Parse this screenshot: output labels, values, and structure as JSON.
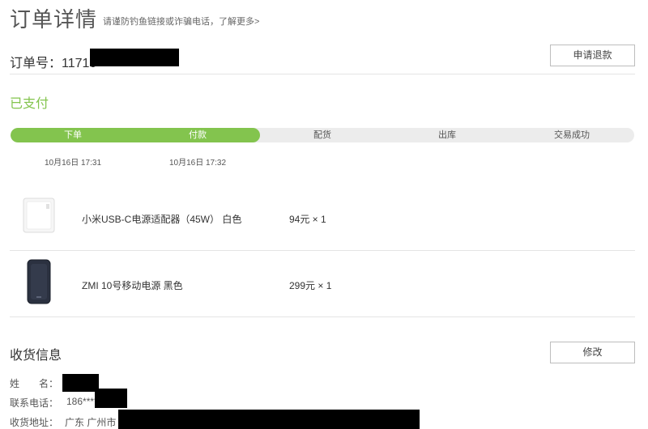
{
  "header": {
    "title": "订单详情",
    "subtitle": "请谨防钓鱼链接或诈骗电话，了解更多>"
  },
  "order": {
    "label": "订单号：",
    "number_visible": "11710",
    "refund_button": "申请退款"
  },
  "status": {
    "text": "已支付",
    "accent_color": "#83c44e",
    "progress_fraction": 0.4,
    "steps": [
      {
        "label": "下单",
        "time": "10月16日 17:31",
        "done": true
      },
      {
        "label": "付款",
        "time": "10月16日 17:32",
        "done": true
      },
      {
        "label": "配货",
        "time": "",
        "done": false
      },
      {
        "label": "出库",
        "time": "",
        "done": false
      },
      {
        "label": "交易成功",
        "time": "",
        "done": false
      }
    ]
  },
  "products": [
    {
      "name": "小米USB-C电源适配器（45W） 白色",
      "price": "94元 × 1",
      "thumb_icon": "power-adapter-icon"
    },
    {
      "name": "ZMI 10号移动电源 黑色",
      "price": "299元 × 1",
      "thumb_icon": "power-bank-icon"
    }
  ],
  "shipping": {
    "title": "收货信息",
    "edit_button": "修改",
    "name_label": "姓　　名：",
    "phone_label": "联系电话：",
    "phone_visible": "186****",
    "address_label": "收货地址：",
    "address_visible": "广东 广州市"
  }
}
